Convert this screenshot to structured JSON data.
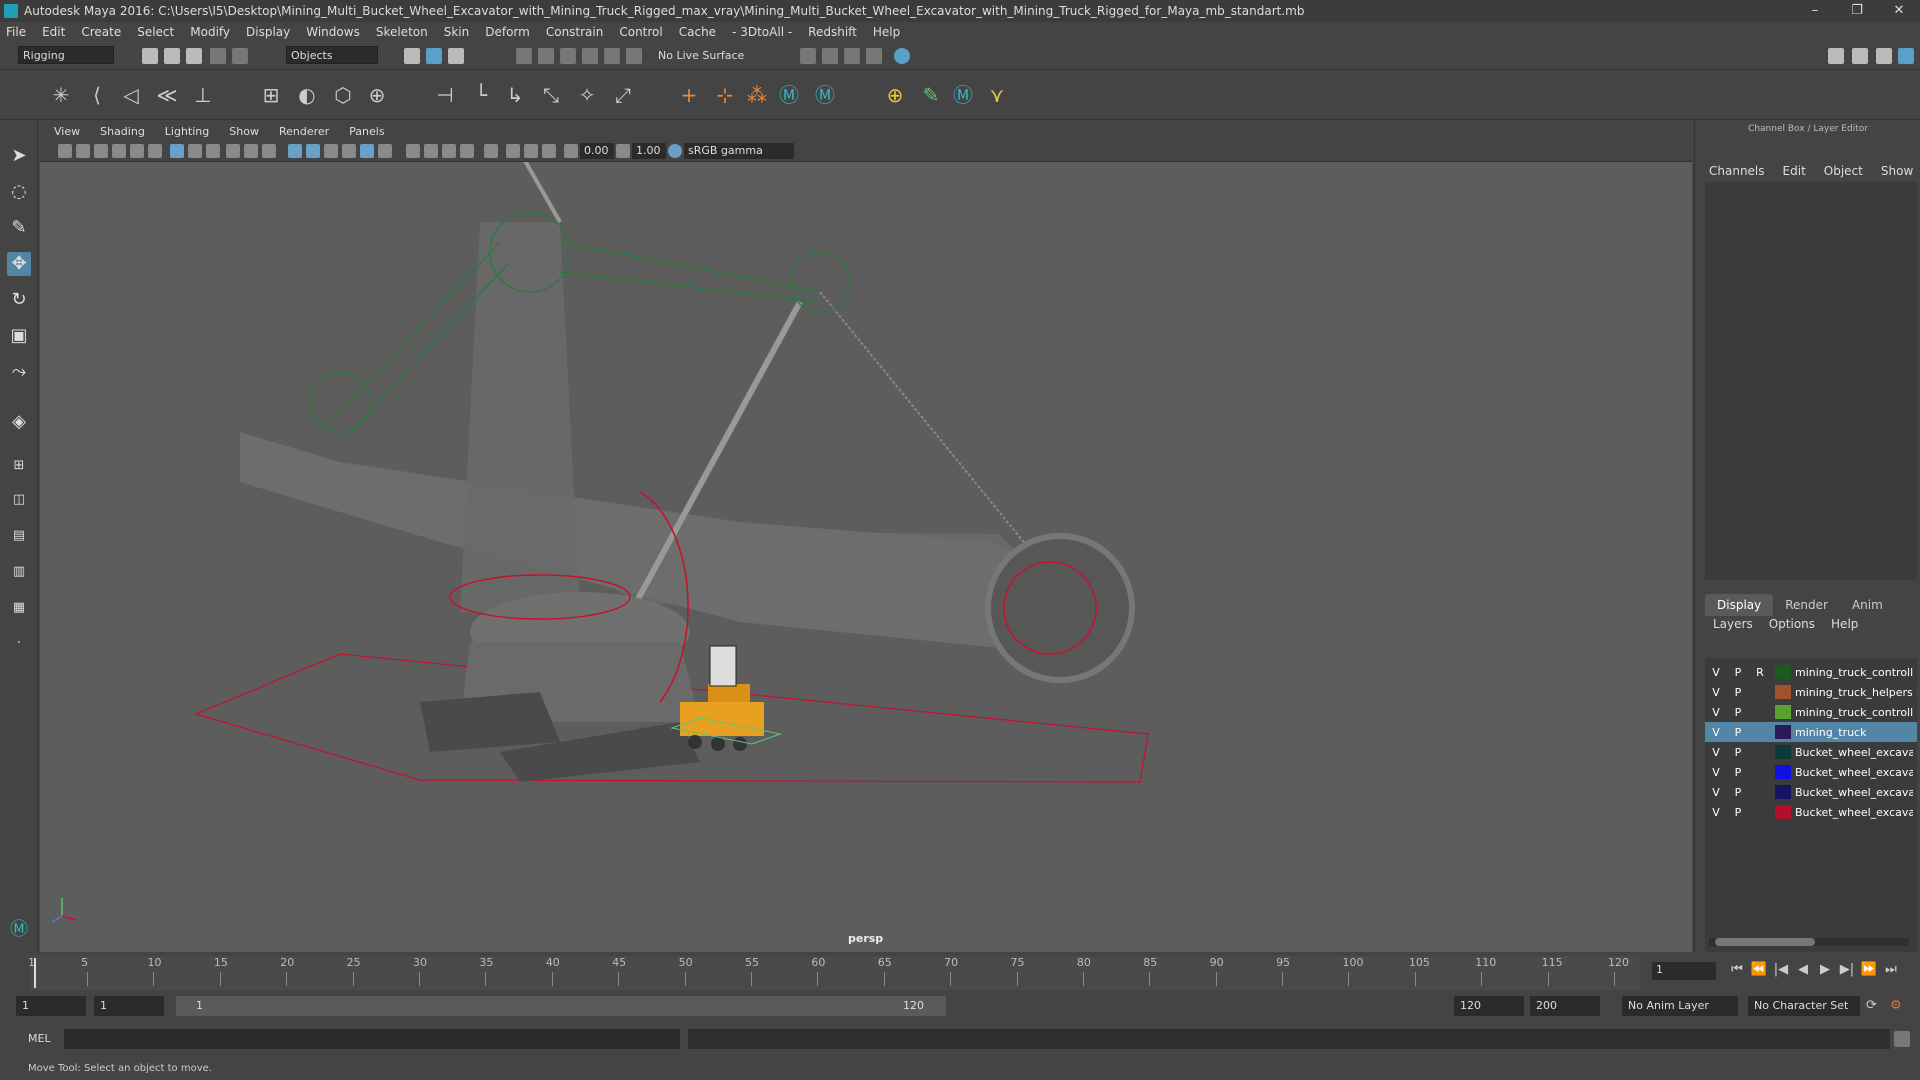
{
  "window": {
    "title": "Autodesk Maya 2016: C:\\Users\\I5\\Desktop\\Mining_Multi_Bucket_Wheel_Excavator_with_Mining_Truck_Rigged_max_vray\\Mining_Multi_Bucket_Wheel_Excavator_with_Mining_Truck_Rigged_for_Maya_mb_standart.mb",
    "minimize": "–",
    "maximize": "❐",
    "close": "✕"
  },
  "menubar": [
    "File",
    "Edit",
    "Create",
    "Select",
    "Modify",
    "Display",
    "Windows",
    "Skeleton",
    "Skin",
    "Deform",
    "Constrain",
    "Control",
    "Cache",
    "- 3DtoAll -",
    "Redshift",
    "Help"
  ],
  "statusline": {
    "menuset": "Rigging",
    "selection_mode": "Objects",
    "live_surface": "No Live Surface"
  },
  "viewport": {
    "menu": [
      "View",
      "Shading",
      "Lighting",
      "Show",
      "Renderer",
      "Panels"
    ],
    "exposure": "0.00",
    "gamma": "1.00",
    "color_space": "sRGB gamma",
    "camera": "persp"
  },
  "channel_box": {
    "title": "Channel Box / Layer Editor",
    "menu": [
      "Channels",
      "Edit",
      "Object",
      "Show"
    ]
  },
  "layer_editor": {
    "tabs": [
      "Display",
      "Render",
      "Anim"
    ],
    "active_tab": "Display",
    "menu": [
      "Layers",
      "Options",
      "Help"
    ],
    "layers": [
      {
        "v": "V",
        "p": "P",
        "r": "R",
        "color": "#1e5a1e",
        "name": "mining_truck_controllers",
        "selected": false
      },
      {
        "v": "V",
        "p": "P",
        "r": "",
        "color": "#a0522d",
        "name": "mining_truck_helpers",
        "selected": false
      },
      {
        "v": "V",
        "p": "P",
        "r": "",
        "color": "#5aa02d",
        "name": "mining_truck_controllers",
        "selected": false
      },
      {
        "v": "V",
        "p": "P",
        "r": "",
        "color": "#2a1a5a",
        "name": "mining_truck",
        "selected": true
      },
      {
        "v": "V",
        "p": "P",
        "r": "",
        "color": "#0a3a3a",
        "name": "Bucket_wheel_excavator",
        "selected": false
      },
      {
        "v": "V",
        "p": "P",
        "r": "",
        "color": "#1010e0",
        "name": "Bucket_wheel_excavator",
        "selected": false
      },
      {
        "v": "V",
        "p": "P",
        "r": "",
        "color": "#141464",
        "name": "Bucket_wheel_excavator",
        "selected": false
      },
      {
        "v": "V",
        "p": "P",
        "r": "",
        "color": "#b0102a",
        "name": "Bucket_wheel_excavator",
        "selected": false
      }
    ]
  },
  "timeline": {
    "ticks": [
      "1",
      "5",
      "10",
      "15",
      "20",
      "25",
      "30",
      "35",
      "40",
      "45",
      "50",
      "55",
      "60",
      "65",
      "70",
      "75",
      "80",
      "85",
      "90",
      "95",
      "100",
      "105",
      "110",
      "115",
      "120"
    ],
    "current_frame": "1",
    "controls": [
      "⏮",
      "⏪",
      "|◀",
      "◀",
      "▶",
      "▶|",
      "⏩",
      "⏭"
    ]
  },
  "range": {
    "start": "1",
    "anim_start": "1",
    "slider_start": "1",
    "slider_end": "120",
    "anim_end": "120",
    "end": "200",
    "anim_layer": "No Anim Layer",
    "character_set": "No Character Set"
  },
  "command": {
    "language": "MEL",
    "help": "Move Tool: Select an object to move."
  }
}
